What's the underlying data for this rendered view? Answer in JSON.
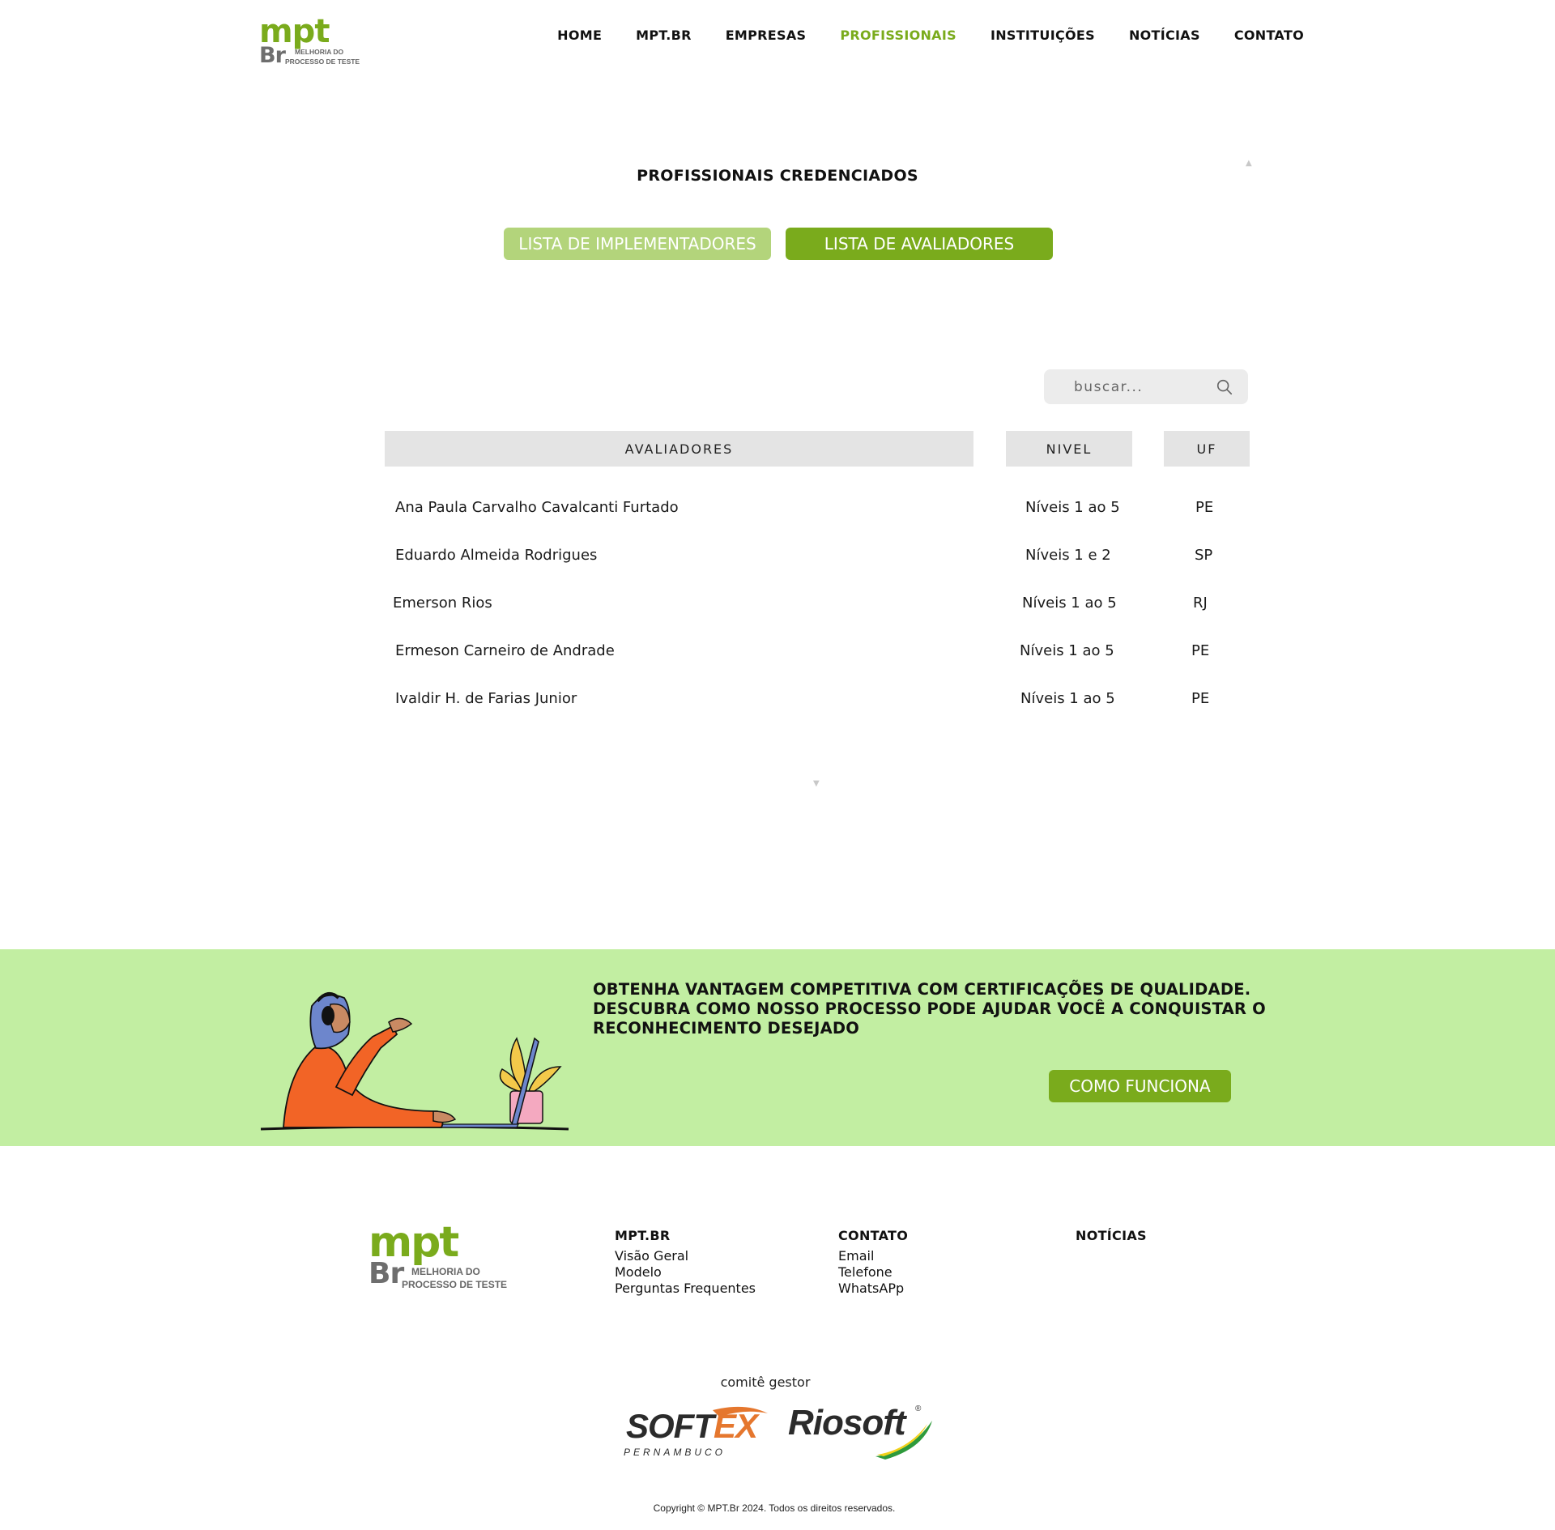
{
  "header": {
    "logo": {
      "mpt": "mpt",
      "br": "Br",
      "tagline_1": "MELHORIA DO",
      "tagline_2": "PROCESSO DE TESTE"
    },
    "nav": [
      "HOME",
      "MPT.BR",
      "EMPRESAS",
      "PROFISSIONAIS",
      "INSTITUIÇÕES",
      "NOTÍCIAS",
      "CONTATO"
    ],
    "active_nav": "PROFISSIONAIS"
  },
  "section": {
    "title": "PROFISSIONAIS CREDENCIADOS",
    "buttons": {
      "implementadores": "LISTA DE IMPLEMENTADORES",
      "avaliadores": "LISTA DE AVALIADORES"
    }
  },
  "search": {
    "placeholder": "buscar...",
    "value": ""
  },
  "table": {
    "headers": {
      "name": "AVALIADORES",
      "nivel": "NIVEL",
      "uf": "UF"
    },
    "rows": [
      {
        "name": "Ana Paula Carvalho Cavalcanti Furtado",
        "nivel": "Níveis 1 ao 5",
        "uf": "PE"
      },
      {
        "name": "Eduardo Almeida Rodrigues",
        "nivel": "Níveis 1 e 2",
        "uf": "SP"
      },
      {
        "name": "Emerson Rios",
        "nivel": "Níveis 1 ao 5",
        "uf": "RJ"
      },
      {
        "name": "Ermeson Carneiro de Andrade",
        "nivel": "Níveis 1 ao 5",
        "uf": "PE"
      },
      {
        "name": "Ivaldir H. de Farias Junior",
        "nivel": "Níveis 1 ao 5",
        "uf": "PE"
      }
    ]
  },
  "banner": {
    "headline": "OBTENHA VANTAGEM COMPETITIVA COM CERTIFICAÇÕES DE QUALIDADE. DESCUBRA COMO NOSSO PROCESSO PODE AJUDAR VOCÊ A CONQUISTAR O RECONHECIMENTO DESEJADO",
    "cta": "COMO FUNCIONA"
  },
  "footer": {
    "logo": {
      "mpt": "mpt",
      "br": "Br",
      "tagline_1": "MELHORIA DO",
      "tagline_2": "PROCESSO DE TESTE"
    },
    "col_mptbr": {
      "title": "MPT.BR",
      "links": [
        "Visão Geral",
        "Modelo",
        "Perguntas Frequentes"
      ]
    },
    "col_contato": {
      "title": "CONTATO",
      "links": [
        "Email",
        "Telefone",
        "WhatsAPp"
      ]
    },
    "col_noticias": {
      "title": "NOTÍCIAS"
    },
    "comite": "comitê gestor",
    "softex": {
      "soft": "SOFT",
      "ex": "EX",
      "sub": "PERNAMBUCO"
    },
    "riosoft": {
      "word": "Riosoft",
      "reg": "®"
    },
    "copyright": "Copyright © MPT.Br 2024. Todos os direitos reservados."
  },
  "colors": {
    "brand_green": "#7aab1c",
    "light_green": "#b3d47b",
    "banner_bg": "#c2eea2",
    "header_gray": "#e4e4e4"
  }
}
